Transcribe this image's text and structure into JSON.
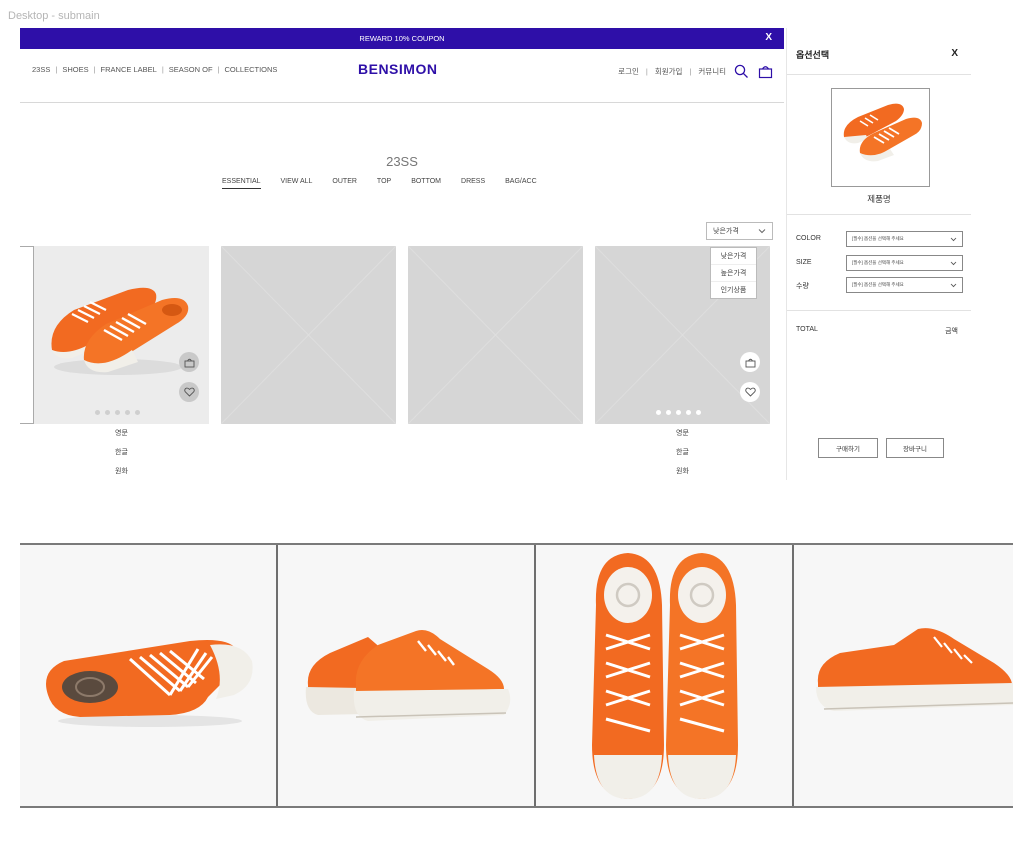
{
  "frame_title": "Desktop - submain",
  "promo": {
    "text": "REWARD 10% COUPON",
    "close": "X"
  },
  "nav": {
    "left_items": [
      "23SS",
      "SHOES",
      "FRANCE LABEL",
      "SEASON OF",
      "COLLECTIONS"
    ],
    "separator": "|",
    "logo": "BENSIMON",
    "right_items": [
      "로그인",
      "회원가입",
      "커뮤니티"
    ],
    "icons": [
      "search-icon",
      "shopping-bag-icon"
    ]
  },
  "category": {
    "title": "23SS",
    "tabs": [
      "ESSENTIAL",
      "VIEW ALL",
      "OUTER",
      "TOP",
      "BOTTOM",
      "DRESS",
      "BAG/ACC"
    ],
    "active_tab": "ESSENTIAL"
  },
  "sort": {
    "selected": "낮은가격",
    "options": [
      "낮은가격",
      "높은가격",
      "인기상품"
    ]
  },
  "products": [
    {
      "name_en": "영문",
      "name_ko": "한글",
      "price": "원화"
    },
    {
      "name_en": "영문",
      "name_ko": "한글",
      "price": "원화"
    }
  ],
  "panel": {
    "title": "옵션선택",
    "close": "X",
    "product_name": "제품명",
    "options": [
      {
        "label": "COLOR",
        "placeholder": "[필수] 옵션을 선택해 주세요"
      },
      {
        "label": "SIZE",
        "placeholder": "[필수] 옵션을 선택해 주세요"
      },
      {
        "label": "수량",
        "placeholder": "[필수] 옵션을 선택해 주세요"
      }
    ],
    "total_label": "TOTAL",
    "total_value": "금액",
    "buy_label": "구매하기",
    "cart_label": "장바구니"
  },
  "colors": {
    "brand": "#2e0fa8",
    "shoe": "#f26a21",
    "placeholder": "#d6d6d6"
  }
}
